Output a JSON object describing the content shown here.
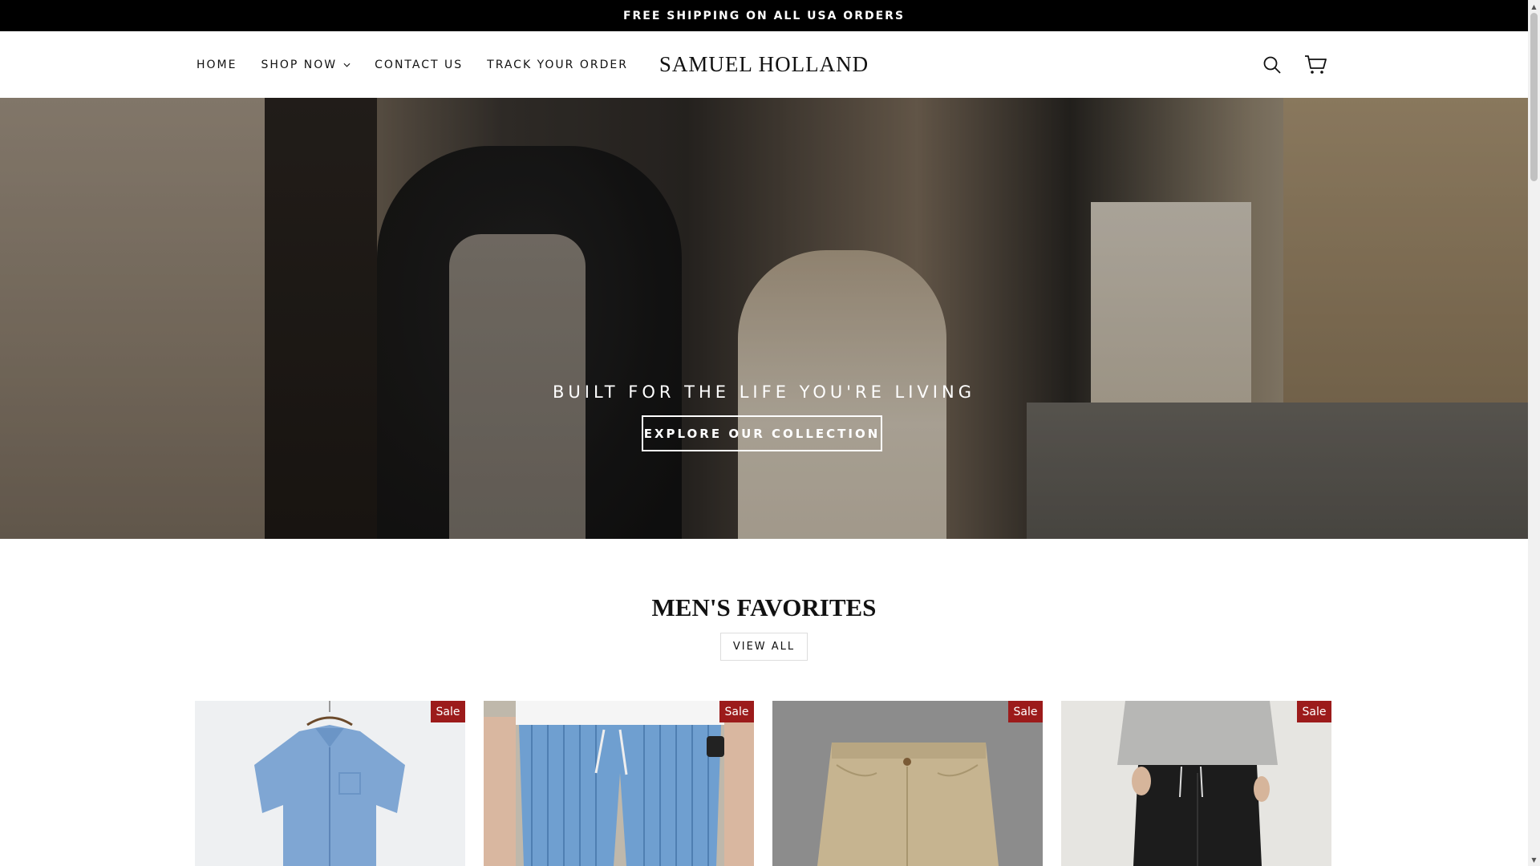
{
  "announcement": {
    "text": "FREE SHIPPING ON ALL USA ORDERS"
  },
  "nav": {
    "items": [
      {
        "label": "HOME"
      },
      {
        "label": "SHOP NOW"
      },
      {
        "label": "CONTACT US"
      },
      {
        "label": "TRACK YOUR ORDER"
      }
    ]
  },
  "brand": {
    "name": "SAMUEL HOLLAND"
  },
  "header_icons": {
    "search": "search-icon",
    "cart": "cart-icon"
  },
  "hero": {
    "title": "BUILT FOR THE LIFE YOU'RE LIVING",
    "button_label": "EXPLORE OUR COLLECTION"
  },
  "favorites": {
    "title": "MEN'S FAVORITES",
    "view_all_label": "VIEW ALL",
    "products": [
      {
        "badge": "Sale"
      },
      {
        "badge": "Sale"
      },
      {
        "badge": "Sale"
      },
      {
        "badge": "Sale"
      }
    ]
  },
  "colors": {
    "sale_badge": "#9c1b1b",
    "announcement_bg": "#000000"
  }
}
